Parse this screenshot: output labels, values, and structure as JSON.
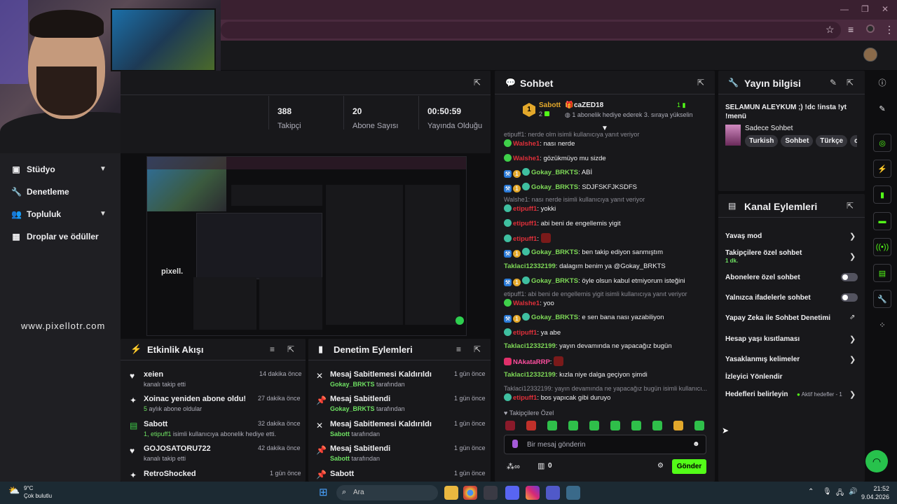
{
  "browser": {
    "window_controls": [
      "—",
      "❐",
      "✕"
    ]
  },
  "webcam": {
    "label": "Streamer camera"
  },
  "leftnav": {
    "items": [
      {
        "label": "Stüdyo",
        "icon": "studio-icon",
        "expandable": true
      },
      {
        "label": "Denetleme",
        "icon": "wrench-icon",
        "expandable": false
      },
      {
        "label": "Topluluk",
        "icon": "people-icon",
        "expandable": true
      },
      {
        "label": "Droplar ve ödüller",
        "icon": "drops-icon",
        "expandable": false
      }
    ],
    "site_url": "www.pixellotr.com"
  },
  "stats": [
    {
      "value": "388",
      "label": "Takipçi"
    },
    {
      "value": "20",
      "label": "Abone Sayısı"
    },
    {
      "value": "00:50:59",
      "label": "Yayında Olduğu Süre"
    }
  ],
  "preview": {
    "watermark": "pixell."
  },
  "activity": {
    "title": "Etkinlik Akışı",
    "items": [
      {
        "icon": "heart-icon",
        "title": "xeien",
        "sub": "kanalı takip etti",
        "time": "14 dakika önce"
      },
      {
        "icon": "sparkle-icon",
        "title": "Xoinac yeniden abone oldu!",
        "sub_hl": "5",
        "sub": "aylık abone oldular",
        "time": "27 dakika önce"
      },
      {
        "icon": "gift-icon",
        "title": "Sabott",
        "sub_hl": "1, etipuff1",
        "sub": "isimli kullanıcıya abonelik hediye etti.",
        "time": "32 dakika önce"
      },
      {
        "icon": "heart-icon",
        "title": "GOJOSATORU722",
        "sub": "kanalı takip etti",
        "time": "42 dakika önce"
      },
      {
        "icon": "sparkle-icon",
        "title": "RetroShocked",
        "sub": "",
        "time": "1 gün önce"
      }
    ]
  },
  "modactions": {
    "title": "Denetim Eylemleri",
    "items": [
      {
        "icon": "unpin-icon",
        "title": "Mesaj Sabitlemesi Kaldırıldı",
        "by": "Gokay_BRKTS",
        "suffix": "tarafından",
        "time": "1 gün önce"
      },
      {
        "icon": "pin-icon",
        "title": "Mesaj Sabitlendi",
        "by": "Gokay_BRKTS",
        "suffix": "tarafından",
        "time": "1 gün önce"
      },
      {
        "icon": "unpin-icon",
        "title": "Mesaj Sabitlemesi Kaldırıldı",
        "by": "Sabott",
        "suffix": "tarafından",
        "time": "1 gün önce"
      },
      {
        "icon": "pin-icon",
        "title": "Mesaj Sabitlendi",
        "by": "Sabott",
        "suffix": "tarafından",
        "time": "1 gün önce"
      },
      {
        "icon": "pin-icon",
        "title": "Sabott",
        "by": "",
        "suffix": "",
        "time": "1 gün önce"
      }
    ]
  },
  "chat": {
    "title": "Sohbet",
    "pinned": {
      "rank": "1",
      "user": "Sabott",
      "count": "2",
      "gifter": "caZED18",
      "gifter_count": "1",
      "text": "1 abonelik hediye ederek 3. sıraya yükselin"
    },
    "messages": [
      {
        "reply": "etipuff1: nerde olm isimli kullanıcıya yanıt veriyor"
      },
      {
        "user": "Walshe1",
        "color": "red",
        "badges": [
          "green"
        ],
        "text": "nası nerde"
      },
      {
        "user": "Walshe1",
        "color": "red",
        "badges": [
          "green"
        ],
        "text": "gözükmüyo mu sizde"
      },
      {
        "user": "Gokay_BRKTS",
        "color": "green",
        "badges": [
          "blue",
          "gold",
          "teal"
        ],
        "text": "ABİ"
      },
      {
        "user": "Gokay_BRKTS",
        "color": "green",
        "badges": [
          "blue",
          "gold",
          "teal"
        ],
        "text": "SDJFSKFJKSDFS"
      },
      {
        "reply": "Walshe1: nası nerde isimli kullanıcıya yanıt veriyor"
      },
      {
        "user": "etipuff1",
        "color": "red",
        "badges": [
          "teal"
        ],
        "text": "yokki"
      },
      {
        "user": "etipuff1",
        "color": "red",
        "badges": [
          "teal"
        ],
        "text": "abi beni de engellemis yigit"
      },
      {
        "user": "etipuff1",
        "color": "red",
        "badges": [
          "teal"
        ],
        "text": "",
        "emote": true
      },
      {
        "user": "Gokay_BRKTS",
        "color": "green",
        "badges": [
          "blue",
          "gold",
          "teal"
        ],
        "text": "ben takip ediyon sanmıştım"
      },
      {
        "user": "Taklaci12332199",
        "color": "green",
        "badges": [],
        "text": "dalagım benim ya @Gokay_BRKTS"
      },
      {
        "user": "Gokay_BRKTS",
        "color": "green",
        "badges": [
          "blue",
          "gold",
          "teal"
        ],
        "text": "öyle olsun kabul etmiyorum isteğini"
      },
      {
        "reply": "etipuff1: abi beni de engellemis yigit isimli kullanıcıya yanıt veriyor"
      },
      {
        "user": "Walshe1",
        "color": "red",
        "badges": [
          "green"
        ],
        "text": "yoo"
      },
      {
        "user": "Gokay_BRKTS",
        "color": "green",
        "badges": [
          "blue",
          "gold",
          "teal"
        ],
        "text": "e sen bana nası yazabiliyon"
      },
      {
        "user": "etipuff1",
        "color": "red",
        "badges": [
          "teal"
        ],
        "text": "ya abe"
      },
      {
        "user": "Taklaci12332199",
        "color": "green",
        "badges": [],
        "text": "yayın devamında ne yapacağız bugün"
      },
      {
        "user": "NAkataRRP",
        "color": "pink",
        "badges": [
          "pinkr"
        ],
        "text": "",
        "emote": true
      },
      {
        "user": "Taklaci12332199",
        "color": "green",
        "badges": [],
        "text": "kızla niye dalga geçiyon şimdi"
      },
      {
        "reply": "Taklaci12332199: yayın devamında ne yapacağız bugün isimli kullanıcı..."
      },
      {
        "user": "etipuff1",
        "color": "red",
        "badges": [
          "teal"
        ],
        "text": "bos yapıcak gibi duruyo"
      }
    ],
    "followers_only": "Takipçilere Özel",
    "input_placeholder": "Bir mesaj gönderin",
    "points": "0",
    "send_label": "Gönder"
  },
  "streaminfo": {
    "title": "Yayın bilgisi",
    "stream_title": "SELAMUN ALEYKUM ;) !dc !insta !yt !menü",
    "category": "Sadece Sohbet",
    "tags": [
      "Turkish",
      "Sohbet",
      "Türkçe",
      "chi"
    ]
  },
  "channelactions": {
    "title": "Kanal Eylemleri",
    "items": [
      {
        "label": "Yavaş mod",
        "control": "chevron"
      },
      {
        "label": "Takipçilere özel sohbet",
        "sub": "1 dk.",
        "control": "chevron"
      },
      {
        "label": "Abonelere özel sohbet",
        "control": "toggle"
      },
      {
        "label": "Yalnızca ifadelerle sohbet",
        "control": "toggle"
      },
      {
        "label": "Yapay Zeka ile Sohbet Denetimi",
        "control": "external"
      },
      {
        "label": "Hesap yaşı kısıtlaması",
        "control": "chevron"
      },
      {
        "label": "Yasaklanmış kelimeler",
        "control": "chevron"
      },
      {
        "label": "İzleyici Yönlendir",
        "control": "none"
      },
      {
        "label": "Hedefleri belirleyin",
        "status": "Aktif hedefler - 1",
        "control": "chevron"
      }
    ]
  },
  "taskbar": {
    "weather_temp": "9°C",
    "weather_desc": "Çok bulutlu",
    "search_placeholder": "Ara",
    "time": "21:52",
    "date": "9.04.2026"
  },
  "colors": {
    "accent": "#53fc18",
    "bg": "#0e0e10",
    "panel": "#18181b"
  }
}
